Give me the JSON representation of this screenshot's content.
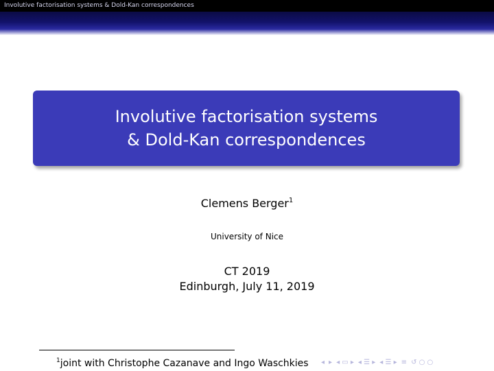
{
  "header": {
    "running_title": "Involutive factorisation systems & Dold-Kan correspondences"
  },
  "title": {
    "line1": "Involutive factorisation systems",
    "line2": "& Dold-Kan correspondences"
  },
  "author": {
    "name": "Clemens Berger",
    "footnote_mark": "1"
  },
  "institute": "University of Nice",
  "event": {
    "name": "CT 2019",
    "location_date": "Edinburgh, July 11, 2019"
  },
  "footnote": {
    "mark": "1",
    "text": "joint with Christophe Cazanave and Ingo Waschkies"
  },
  "navigation": {
    "icons": [
      "nav-left-icon",
      "nav-right-icon",
      "frame-icon",
      "subsection-icon",
      "section-icon",
      "align-icon",
      "search-icon"
    ],
    "color": "#b6b6dc"
  },
  "colors": {
    "title_box": "#3b3bb8",
    "header_bar": "#000000"
  }
}
